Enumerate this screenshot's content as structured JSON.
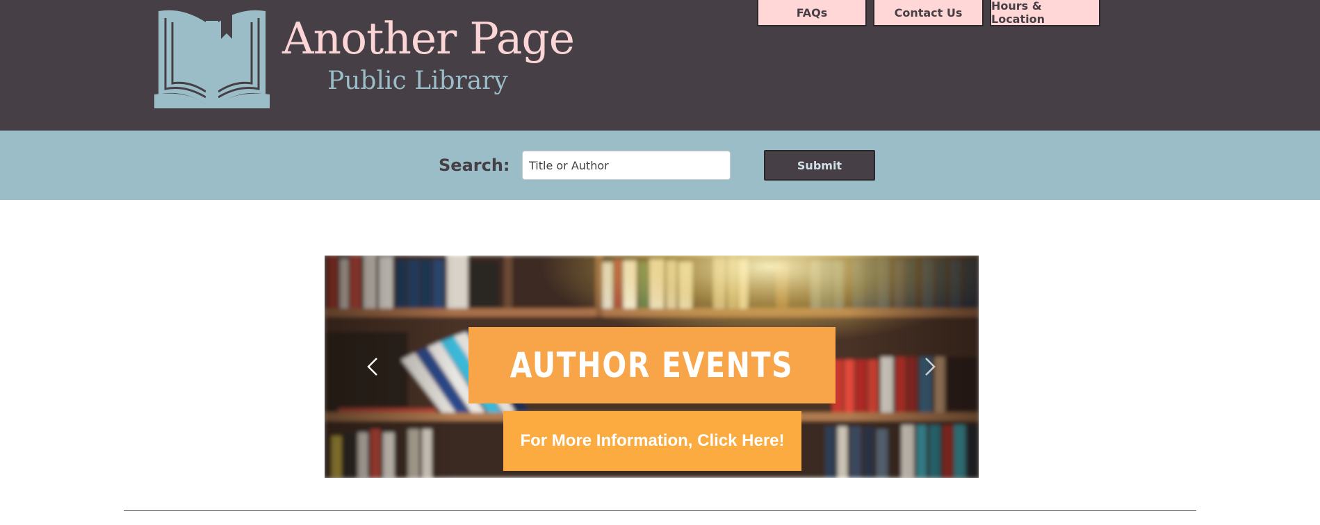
{
  "header": {
    "title": "Another Page",
    "subtitle": "Public Library",
    "logo_icon": "open-book-icon",
    "nav": [
      {
        "label": "FAQs"
      },
      {
        "label": "Contact Us"
      },
      {
        "label": "Hours & Location"
      }
    ]
  },
  "search": {
    "label": "Search:",
    "placeholder": "Title or Author",
    "value": "",
    "submit_label": "Submit"
  },
  "banner": {
    "title": "AUTHOR EVENTS",
    "cta": "For More Information, Click Here!",
    "prev_icon": "chevron-left-icon",
    "next_icon": "chevron-right-icon"
  },
  "colors": {
    "header_bg": "#464046",
    "search_band_bg": "#9bbdc7",
    "nav_button_bg": "#ffd7d7",
    "title_color": "#fcd6d6",
    "subtitle_color": "#9bbdc7",
    "banner_orange": "#f8a448"
  }
}
